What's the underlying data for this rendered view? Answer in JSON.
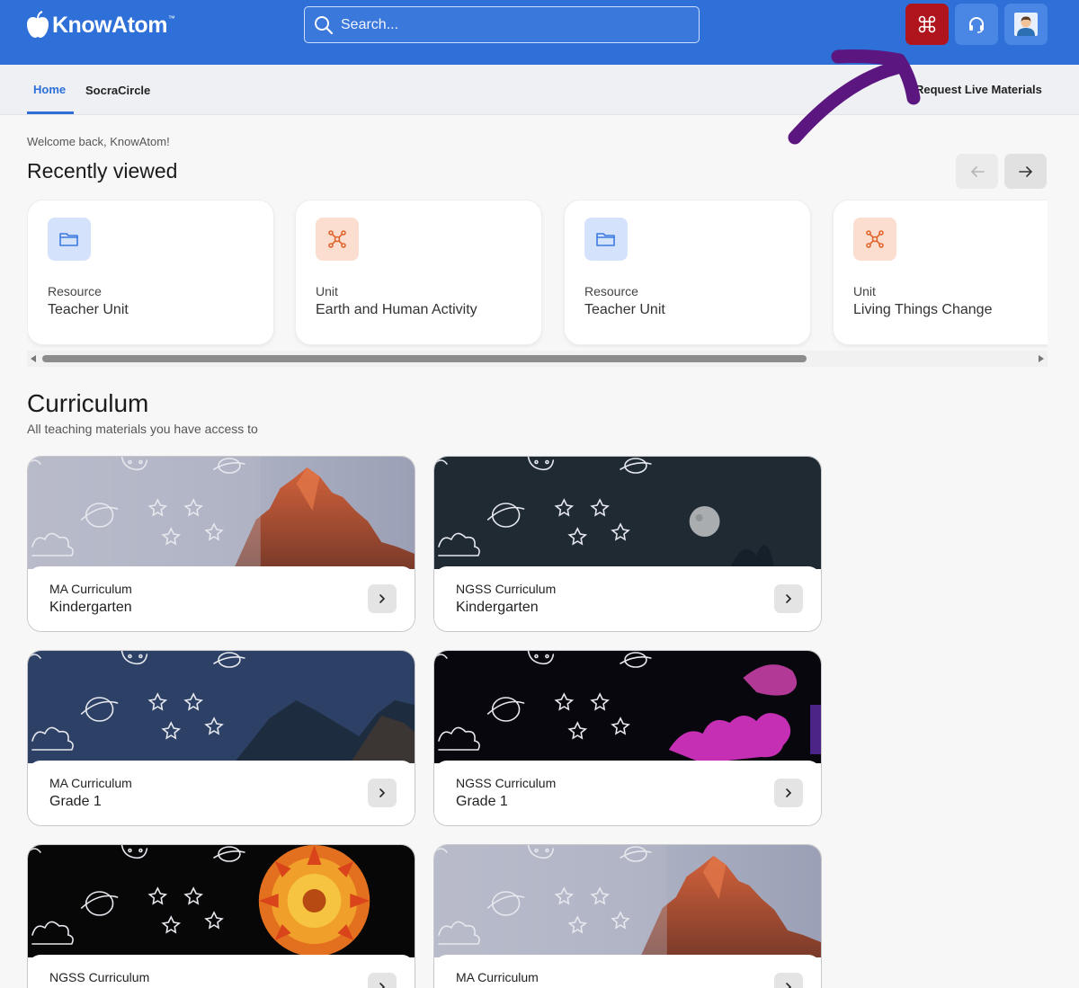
{
  "header": {
    "brand": "KnowAtom",
    "brand_mark": "™",
    "search_placeholder": "Search...",
    "colors": {
      "bar": "#2e6fd8",
      "apps_button": "#b0141c"
    }
  },
  "tabs": [
    {
      "label": "Home",
      "active": true
    },
    {
      "label": "SocraCircle",
      "active": false
    }
  ],
  "tabbar_action": "Request Live Materials",
  "welcome": "Welcome back, KnowAtom!",
  "recently_viewed": {
    "title": "Recently viewed",
    "cards": [
      {
        "kind": "Resource",
        "name": "Teacher Unit",
        "icon": "folder-icon"
      },
      {
        "kind": "Unit",
        "name": "Earth and Human Activity",
        "icon": "network-icon"
      },
      {
        "kind": "Resource",
        "name": "Teacher Unit",
        "icon": "folder-icon"
      },
      {
        "kind": "Unit",
        "name": "Living Things Change",
        "icon": "network-icon"
      }
    ]
  },
  "curriculum": {
    "title": "Curriculum",
    "subtitle": "All teaching materials you have access to",
    "cards": [
      {
        "kind": "MA Curriculum",
        "name": "Kindergarten",
        "theme": "dolomite-dusk"
      },
      {
        "kind": "NGSS Curriculum",
        "name": "Kindergarten",
        "theme": "night-moon"
      },
      {
        "kind": "MA Curriculum",
        "name": "Grade 1",
        "theme": "blue-mountains"
      },
      {
        "kind": "NGSS Curriculum",
        "name": "Grade 1",
        "theme": "deep-sea-coral"
      },
      {
        "kind": "NGSS Curriculum",
        "name": "",
        "theme": "orange-flower"
      },
      {
        "kind": "MA Curriculum",
        "name": "",
        "theme": "dolomite-dusk"
      }
    ]
  }
}
